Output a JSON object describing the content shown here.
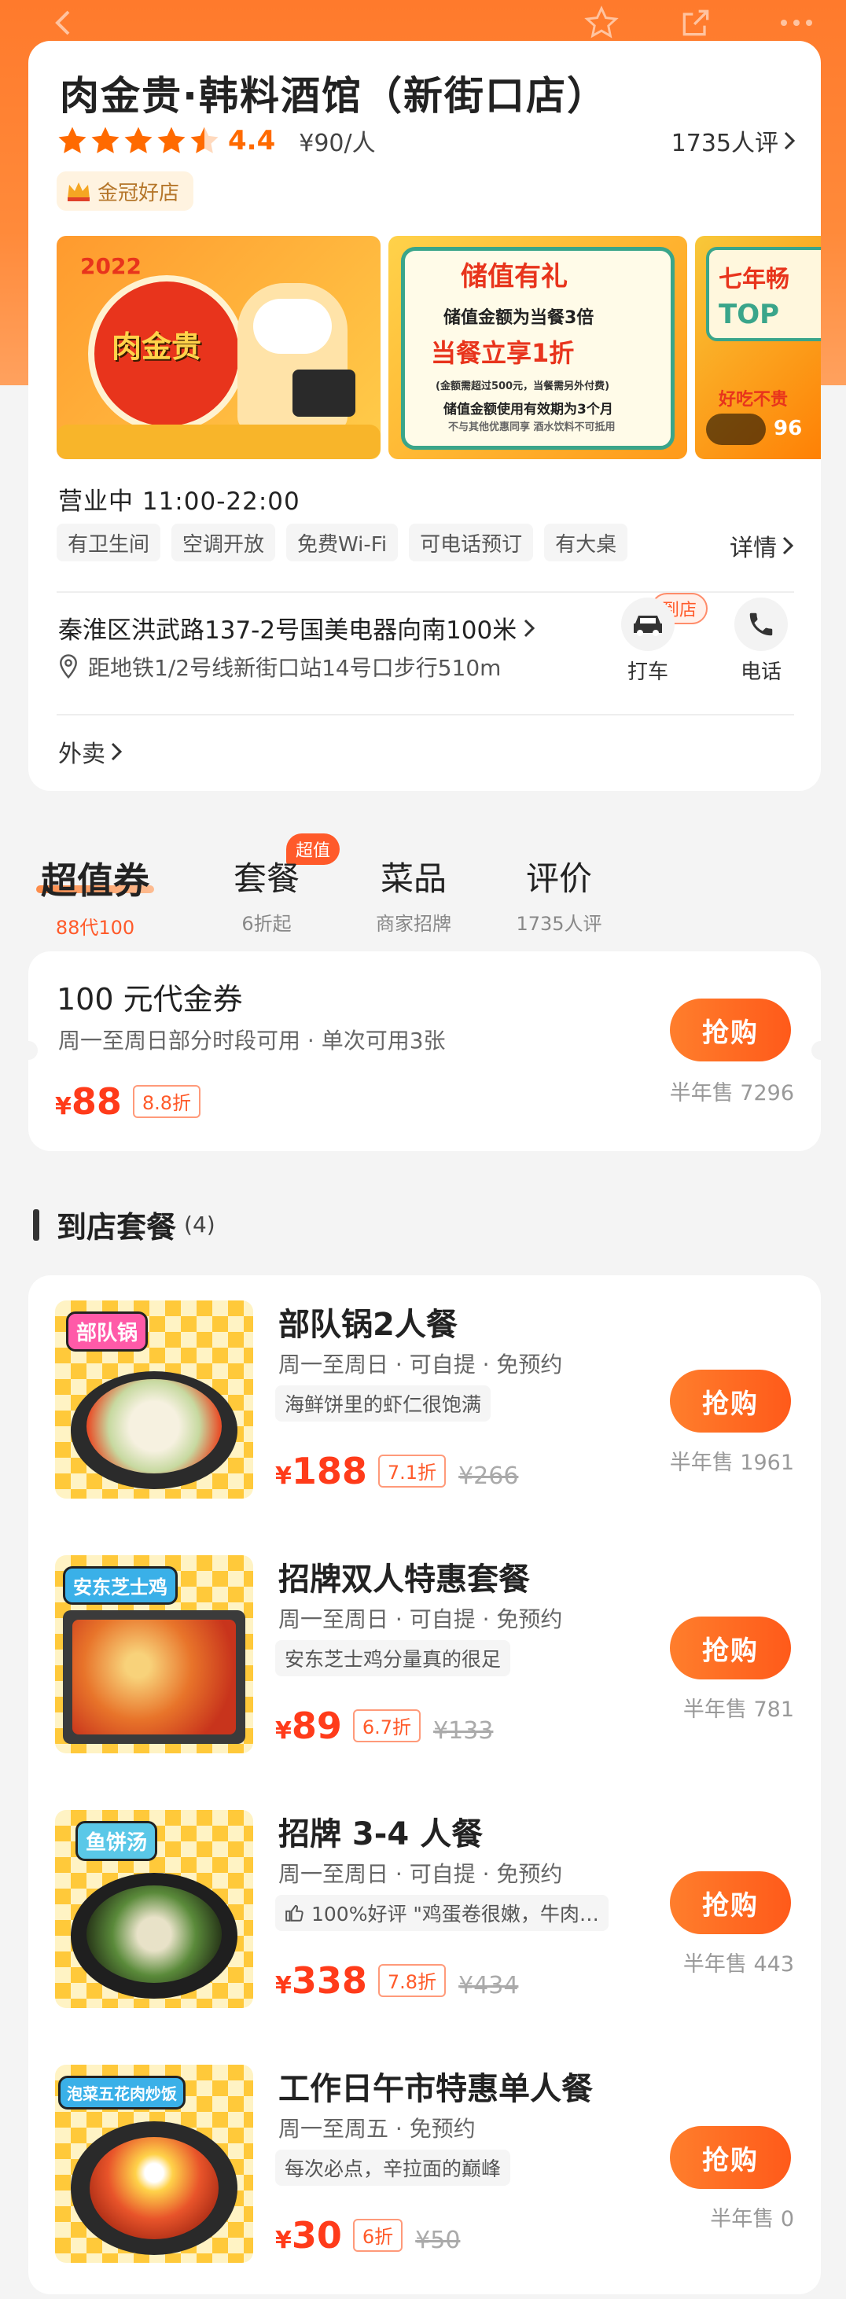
{
  "shop": {
    "title": "肉金贵·韩料酒馆（新街口店）",
    "score": "4.4",
    "price": "¥90/人",
    "reviews": "1735人评",
    "badge": "金冠好店",
    "hours": "营业中  11:00-22:00",
    "detail_label": "详情",
    "tags": [
      "有卫生间",
      "空调开放",
      "免费Wi-Fi",
      "可电话预订",
      "有大桌"
    ],
    "address": "秦淮区洪武路137-2号国美电器向南100米",
    "metro": "距地铁1/2号线新街口站14号口步行510m",
    "taxi_label": "打车",
    "phone_label": "电话",
    "arrive_badge": "到店",
    "takeaway": "外卖",
    "gallery": {
      "img1_text": "肉金贵",
      "img1_year": "2022",
      "img2_title": "储值有礼",
      "img2_line1": "储值金额为当餐3倍",
      "img2_line2": "当餐立享1折",
      "img2_line3": "(金额需超过500元，当餐需另外付费)",
      "img2_line4": "储值金额使用有效期为3个月",
      "img2_line5": "不与其他优惠同享 酒水饮料不可抵用",
      "img3_title": "七年畅",
      "img3_sub": "TOP",
      "img3_count": "96",
      "img3_bottom": "好吃不贵"
    }
  },
  "tabs": [
    {
      "label": "超值券",
      "sub": "88代100"
    },
    {
      "label": "套餐",
      "sub": "6折起"
    },
    {
      "label": "菜品",
      "sub": "商家招牌"
    },
    {
      "label": "评价",
      "sub": "1735人评"
    }
  ],
  "hot_badge": "超值",
  "voucher": {
    "title": "100 元代金券",
    "desc": "周一至周日部分时段可用 · 单次可用3张",
    "yen": "¥",
    "price": "88",
    "discount": "8.8折",
    "buy": "抢购",
    "sold": "半年售 7296"
  },
  "section": {
    "title": "到店套餐",
    "count": "(4)"
  },
  "packages": [
    {
      "name": "部队锅2人餐",
      "meta": "周一至周日 · 可自提 · 免预约",
      "tag": "海鲜饼里的虾仁很饱满",
      "price": "188",
      "discount": "7.1折",
      "orig": "¥266",
      "buy": "抢购",
      "sold": "半年售 1961",
      "img_label": "部队锅"
    },
    {
      "name": "招牌双人特惠套餐",
      "meta": "周一至周日 · 可自提 · 免预约",
      "tag": "安东芝士鸡分量真的很足",
      "price": "89",
      "discount": "6.7折",
      "orig": "¥133",
      "buy": "抢购",
      "sold": "半年售 781",
      "img_label": "安东芝士鸡"
    },
    {
      "name": "招牌 3-4 人餐",
      "meta": "周一至周日 · 可自提 · 免预约",
      "tag": "100%好评 \"鸡蛋卷很嫩，牛肉…",
      "price": "338",
      "discount": "7.8折",
      "orig": "¥434",
      "buy": "抢购",
      "sold": "半年售 443",
      "img_label": "鱼饼汤"
    },
    {
      "name": "工作日午市特惠单人餐",
      "meta": "周一至周五 · 免预约",
      "tag": "每次必点，辛拉面的巅峰",
      "price": "30",
      "discount": "6折",
      "orig": "¥50",
      "buy": "抢购",
      "sold": "半年售 0",
      "img_label": "泡菜五花肉炒饭"
    }
  ],
  "colors": {
    "brand": "#ff6a1a",
    "price": "#ff3b1a",
    "star": "#ff6a00"
  }
}
